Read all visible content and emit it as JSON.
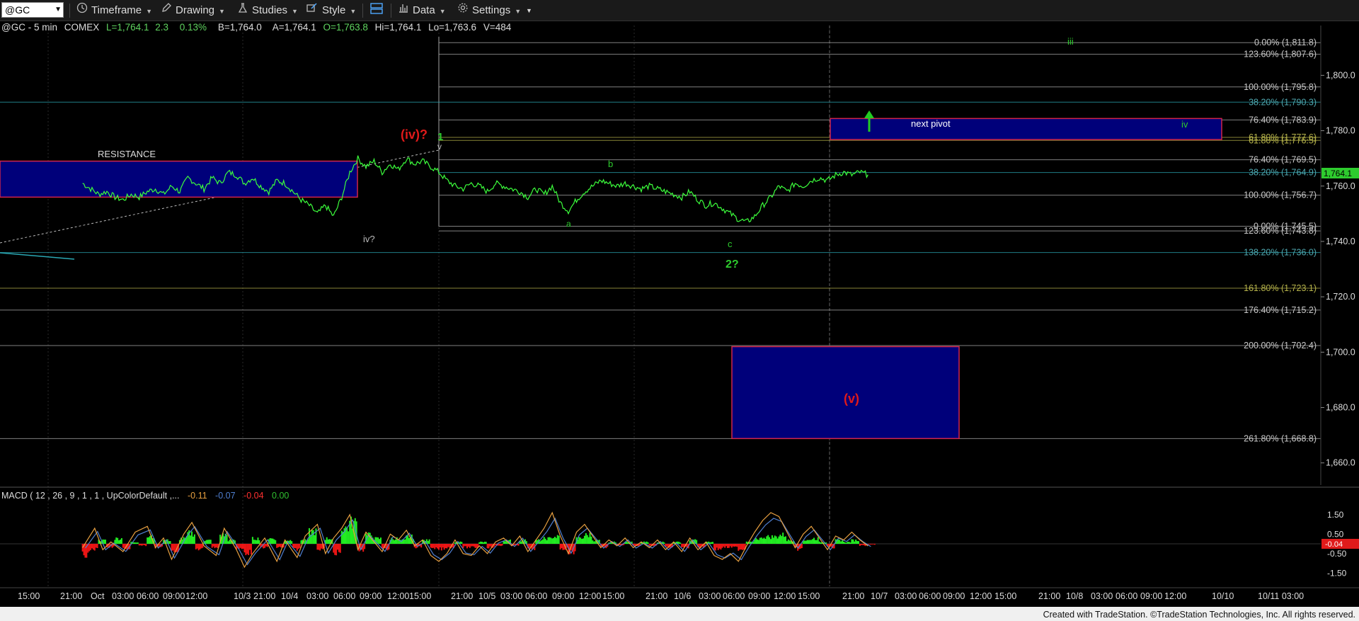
{
  "toolbar": {
    "symbol": "@GC",
    "timeframe": "Timeframe",
    "drawing": "Drawing",
    "studies": "Studies",
    "style": "Style",
    "data": "Data",
    "settings": "Settings"
  },
  "header": {
    "symbol": "@GC - 5 min",
    "exchange": "COMEX",
    "last": "L=1,764.1",
    "change": "2.3",
    "change_pct": "0.13%",
    "bid": "B=1,764.0",
    "ask": "A=1,764.1",
    "open": "O=1,763.8",
    "high": "Hi=1,764.1",
    "low": "Lo=1,763.6",
    "volume": "V=484"
  },
  "price_axis": {
    "ticks": [
      "1,800.0",
      "1,780.0",
      "1,760.0",
      "1,740.0",
      "1,720.0",
      "1,700.0",
      "1,680.0",
      "1,660.0"
    ],
    "last_price": "1,764.1"
  },
  "fib_labels": [
    {
      "text": "0.00% (1,811.8)",
      "color": "#c8c8c8"
    },
    {
      "text": "123.60% (1,807.6)",
      "color": "#c8c8c8"
    },
    {
      "text": "100.00% (1,795.8)",
      "color": "#c8c8c8"
    },
    {
      "text": "38.20% (1,790.3)",
      "color": "#4fa8b0"
    },
    {
      "text": "76.40% (1,783.9)",
      "color": "#c8c8c8"
    },
    {
      "text": "61.80% (1,777.6)",
      "color": "#b5b24a"
    },
    {
      "text": "61.80% (1,776.5)",
      "color": "#b5b24a"
    },
    {
      "text": "76.40% (1,769.5)",
      "color": "#c8c8c8"
    },
    {
      "text": "38.20% (1,764.9)",
      "color": "#4fa8b0"
    },
    {
      "text": "100.00% (1,756.7)",
      "color": "#c8c8c8"
    },
    {
      "text": "0.00% (1,745.5)",
      "color": "#c8c8c8"
    },
    {
      "text": "123.60% (1,743.8)",
      "color": "#c8c8c8"
    },
    {
      "text": "138.20% (1,736.0)",
      "color": "#4fa8b0"
    },
    {
      "text": "161.80% (1,723.1)",
      "color": "#b5b24a"
    },
    {
      "text": "176.40% (1,715.2)",
      "color": "#c8c8c8"
    },
    {
      "text": "200.00% (1,702.4)",
      "color": "#c8c8c8"
    },
    {
      "text": "261.80% (1,668.8)",
      "color": "#c8c8c8"
    }
  ],
  "annotations": {
    "resistance": "RESISTANCE",
    "next_pivot": "next pivot",
    "wave_iv_red": "(iv)?",
    "wave_1": "1",
    "wave_v_small": "v",
    "wave_iv_q": "iv?",
    "wave_a": "a",
    "wave_b": "b",
    "wave_c": "c",
    "wave_2q": "2?",
    "wave_iii": "iii",
    "wave_iv_small": "iv",
    "wave_v_red": "(v)"
  },
  "macd": {
    "label": "MACD ( 12 , 26 , 9 , 1 , 1 , UpColorDefault ,...",
    "values": [
      "-0.11",
      "-0.07",
      "-0.04",
      "0.00"
    ],
    "value_colors": [
      "#e8a040",
      "#4f7fd0",
      "#ff3030",
      "#30c030"
    ],
    "ticks": [
      "1.50",
      "0.50",
      "-0.50",
      "-1.50"
    ],
    "current": "-0.04"
  },
  "time_axis": {
    "labels": [
      "15:00",
      "21:00",
      "Oct",
      "03:00",
      "06:00",
      "09:00",
      "12:00",
      "10/3",
      "21:00",
      "10/4",
      "03:00",
      "06:00",
      "09:00",
      "12:00",
      "15:00",
      "21:00",
      "10/5",
      "03:00",
      "06:00",
      "09:00",
      "12:00",
      "15:00",
      "21:00",
      "10/6",
      "03:00",
      "06:00",
      "09:00",
      "12:00",
      "15:00",
      "21:00",
      "10/7",
      "03:00",
      "06:00",
      "09:00",
      "12:00",
      "15:00",
      "21:00",
      "10/8",
      "03:00",
      "06:00",
      "09:00",
      "12:00",
      "10/10",
      "10/11 03:00"
    ]
  },
  "footer": "Created with TradeStation. ©TradeStation Technologies, Inc. All rights reserved.",
  "chart_data": {
    "type": "line",
    "title": "@GC - 5 min COMEX",
    "ylabel": "",
    "ylim": [
      1652,
      1818
    ],
    "last": 1764.1,
    "price_path": [
      [
        0,
        1761
      ],
      [
        0.02,
        1759
      ],
      [
        0.04,
        1757
      ],
      [
        0.06,
        1758
      ],
      [
        0.08,
        1756
      ],
      [
        0.1,
        1755
      ],
      [
        0.12,
        1757
      ],
      [
        0.14,
        1756
      ],
      [
        0.16,
        1758
      ],
      [
        0.18,
        1759
      ],
      [
        0.2,
        1757
      ],
      [
        0.22,
        1760
      ],
      [
        0.24,
        1758
      ],
      [
        0.26,
        1763
      ],
      [
        0.28,
        1761
      ],
      [
        0.3,
        1759
      ],
      [
        0.32,
        1763
      ],
      [
        0.34,
        1761
      ],
      [
        0.36,
        1765
      ],
      [
        0.38,
        1764
      ],
      [
        0.4,
        1761
      ],
      [
        0.42,
        1763
      ],
      [
        0.44,
        1760
      ],
      [
        0.46,
        1758
      ],
      [
        0.48,
        1762
      ],
      [
        0.5,
        1761
      ],
      [
        0.52,
        1758
      ],
      [
        0.54,
        1755
      ],
      [
        0.56,
        1753
      ],
      [
        0.58,
        1750
      ],
      [
        0.6,
        1753
      ],
      [
        0.62,
        1749
      ],
      [
        0.64,
        1756
      ],
      [
        0.66,
        1765
      ],
      [
        0.68,
        1770
      ],
      [
        0.7,
        1767
      ],
      [
        0.72,
        1769
      ],
      [
        0.74,
        1765
      ],
      [
        0.76,
        1768
      ],
      [
        0.78,
        1766
      ],
      [
        0.8,
        1770
      ],
      [
        0.82,
        1768
      ],
      [
        0.84,
        1769
      ],
      [
        0.86,
        1767
      ],
      [
        0.88,
        1765
      ],
      [
        0.9,
        1762
      ],
      [
        0.92,
        1760
      ],
      [
        0.94,
        1759
      ],
      [
        0.96,
        1761
      ],
      [
        0.98,
        1760
      ],
      [
        1,
        1758
      ],
      [
        1.02,
        1761
      ],
      [
        1.04,
        1760
      ],
      [
        1.06,
        1759
      ],
      [
        1.08,
        1758
      ],
      [
        1.1,
        1756
      ],
      [
        1.12,
        1759
      ],
      [
        1.14,
        1757
      ],
      [
        1.16,
        1760
      ],
      [
        1.18,
        1754
      ],
      [
        1.2,
        1751
      ],
      [
        1.22,
        1755
      ],
      [
        1.24,
        1758
      ],
      [
        1.26,
        1760
      ],
      [
        1.28,
        1762
      ],
      [
        1.3,
        1761
      ],
      [
        1.32,
        1760
      ],
      [
        1.34,
        1761
      ],
      [
        1.36,
        1760
      ],
      [
        1.38,
        1759
      ],
      [
        1.4,
        1760
      ],
      [
        1.42,
        1759
      ],
      [
        1.44,
        1758
      ],
      [
        1.46,
        1757
      ],
      [
        1.48,
        1756
      ],
      [
        1.5,
        1758
      ],
      [
        1.52,
        1755
      ],
      [
        1.54,
        1753
      ],
      [
        1.56,
        1754
      ],
      [
        1.58,
        1752
      ],
      [
        1.6,
        1750
      ],
      [
        1.62,
        1748
      ],
      [
        1.64,
        1747
      ],
      [
        1.66,
        1749
      ],
      [
        1.68,
        1753
      ],
      [
        1.7,
        1756
      ],
      [
        1.72,
        1760
      ],
      [
        1.74,
        1758
      ],
      [
        1.76,
        1761
      ],
      [
        1.78,
        1760
      ],
      [
        1.8,
        1762
      ],
      [
        1.82,
        1763
      ],
      [
        1.84,
        1762
      ],
      [
        1.86,
        1764
      ],
      [
        1.88,
        1765
      ],
      [
        1.9,
        1764
      ],
      [
        1.92,
        1765
      ],
      [
        1.94,
        1764.1
      ]
    ],
    "fib_levels": [
      1811.8,
      1807.6,
      1795.8,
      1790.3,
      1783.9,
      1777.6,
      1776.5,
      1769.5,
      1764.9,
      1756.7,
      1745.5,
      1743.8,
      1736.0,
      1723.1,
      1715.2,
      1702.4,
      1668.8
    ],
    "zones": [
      {
        "label": "RESISTANCE",
        "top": 1769.0,
        "bottom": 1756.0
      },
      {
        "label": "next pivot",
        "top": 1784.4,
        "bottom": 1776.8
      },
      {
        "label": "(v)",
        "top": 1702.0,
        "bottom": 1668.8
      }
    ],
    "macd": {
      "ylim": [
        -2.2,
        2.2
      ],
      "hist": [
        [
          0,
          -0.6
        ],
        [
          0.02,
          -0.3
        ],
        [
          0.04,
          0.2
        ],
        [
          0.06,
          -0.2
        ],
        [
          0.08,
          0.3
        ],
        [
          0.1,
          -0.3
        ],
        [
          0.12,
          0.1
        ],
        [
          0.14,
          -0.1
        ],
        [
          0.16,
          0.4
        ],
        [
          0.18,
          -0.2
        ],
        [
          0.2,
          0.2
        ],
        [
          0.22,
          -0.4
        ],
        [
          0.24,
          0.3
        ],
        [
          0.26,
          0.6
        ],
        [
          0.28,
          -0.3
        ],
        [
          0.3,
          0.2
        ],
        [
          0.32,
          -0.2
        ],
        [
          0.34,
          0.5
        ],
        [
          0.36,
          0.2
        ],
        [
          0.38,
          -0.3
        ],
        [
          0.4,
          -0.5
        ],
        [
          0.42,
          0.3
        ],
        [
          0.44,
          -0.2
        ],
        [
          0.46,
          0.3
        ],
        [
          0.48,
          -0.2
        ],
        [
          0.5,
          0.2
        ],
        [
          0.52,
          -0.3
        ],
        [
          0.54,
          0.2
        ],
        [
          0.56,
          0.7
        ],
        [
          0.58,
          -0.3
        ],
        [
          0.6,
          0.3
        ],
        [
          0.62,
          -0.5
        ],
        [
          0.64,
          0.9
        ],
        [
          0.66,
          1.2
        ],
        [
          0.68,
          -0.4
        ],
        [
          0.7,
          0.5
        ],
        [
          0.72,
          0.3
        ],
        [
          0.74,
          -0.3
        ],
        [
          0.76,
          0.3
        ],
        [
          0.78,
          0.2
        ],
        [
          0.8,
          0.4
        ],
        [
          0.82,
          -0.2
        ],
        [
          0.84,
          0.2
        ],
        [
          0.86,
          -0.3
        ],
        [
          0.88,
          -0.3
        ],
        [
          0.9,
          -0.2
        ],
        [
          0.92,
          0.1
        ],
        [
          0.94,
          -0.2
        ],
        [
          0.96,
          -0.2
        ],
        [
          0.98,
          0.1
        ],
        [
          1,
          -0.2
        ],
        [
          1.02,
          -0.1
        ],
        [
          1.04,
          0.2
        ],
        [
          1.06,
          -0.1
        ],
        [
          1.08,
          0.2
        ],
        [
          1.1,
          -0.3
        ],
        [
          1.12,
          0.2
        ],
        [
          1.14,
          0.3
        ],
        [
          1.16,
          0.4
        ],
        [
          1.18,
          -0.3
        ],
        [
          1.2,
          -0.5
        ],
        [
          1.22,
          0.3
        ],
        [
          1.24,
          0.5
        ],
        [
          1.26,
          0.2
        ],
        [
          1.28,
          -0.2
        ],
        [
          1.3,
          0.1
        ],
        [
          1.32,
          -0.1
        ],
        [
          1.34,
          0.1
        ],
        [
          1.36,
          -0.1
        ],
        [
          1.38,
          0.1
        ],
        [
          1.4,
          -0.1
        ],
        [
          1.42,
          0.1
        ],
        [
          1.44,
          -0.2
        ],
        [
          1.46,
          0.1
        ],
        [
          1.48,
          -0.2
        ],
        [
          1.5,
          0.2
        ],
        [
          1.52,
          -0.2
        ],
        [
          1.54,
          0.1
        ],
        [
          1.56,
          -0.3
        ],
        [
          1.58,
          -0.2
        ],
        [
          1.6,
          -0.2
        ],
        [
          1.62,
          -0.3
        ],
        [
          1.64,
          0.1
        ],
        [
          1.66,
          0.3
        ],
        [
          1.68,
          0.4
        ],
        [
          1.7,
          0.4
        ],
        [
          1.72,
          0.5
        ],
        [
          1.74,
          0.2
        ],
        [
          1.76,
          -0.3
        ],
        [
          1.78,
          0.2
        ],
        [
          1.8,
          0.3
        ],
        [
          1.82,
          0.1
        ],
        [
          1.84,
          -0.2
        ],
        [
          1.86,
          0.2
        ],
        [
          1.88,
          0.1
        ],
        [
          1.9,
          0.2
        ],
        [
          1.92,
          -0.1
        ],
        [
          1.94,
          -0.04
        ]
      ],
      "macd_line": [
        [
          0,
          -0.2
        ],
        [
          0.03,
          0.8
        ],
        [
          0.05,
          -0.3
        ],
        [
          0.07,
          0.1
        ],
        [
          0.1,
          -0.4
        ],
        [
          0.13,
          0.6
        ],
        [
          0.16,
          0.9
        ],
        [
          0.18,
          -0.2
        ],
        [
          0.2,
          0.3
        ],
        [
          0.22,
          -0.8
        ],
        [
          0.25,
          0.5
        ],
        [
          0.27,
          1.1
        ],
        [
          0.3,
          -0.1
        ],
        [
          0.33,
          -0.6
        ],
        [
          0.35,
          0.8
        ],
        [
          0.38,
          -0.3
        ],
        [
          0.4,
          -1.2
        ],
        [
          0.42,
          -0.5
        ],
        [
          0.45,
          0.3
        ],
        [
          0.48,
          -0.9
        ],
        [
          0.5,
          0.2
        ],
        [
          0.53,
          -0.7
        ],
        [
          0.55,
          0.4
        ],
        [
          0.58,
          1.0
        ],
        [
          0.6,
          -0.5
        ],
        [
          0.62,
          0.3
        ],
        [
          0.64,
          0.8
        ],
        [
          0.66,
          1.5
        ],
        [
          0.68,
          -0.3
        ],
        [
          0.7,
          0.6
        ],
        [
          0.72,
          0.1
        ],
        [
          0.74,
          -0.4
        ],
        [
          0.76,
          0.5
        ],
        [
          0.78,
          0.2
        ],
        [
          0.8,
          0.7
        ],
        [
          0.82,
          -0.1
        ],
        [
          0.84,
          0.2
        ],
        [
          0.86,
          -0.6
        ],
        [
          0.88,
          -0.9
        ],
        [
          0.9,
          -0.5
        ],
        [
          0.92,
          0.2
        ],
        [
          0.94,
          -0.5
        ],
        [
          0.96,
          -0.6
        ],
        [
          0.98,
          -0.1
        ],
        [
          1,
          -0.5
        ],
        [
          1.02,
          0.1
        ],
        [
          1.04,
          0.3
        ],
        [
          1.06,
          -0.1
        ],
        [
          1.08,
          0.4
        ],
        [
          1.1,
          -0.4
        ],
        [
          1.12,
          0.2
        ],
        [
          1.14,
          0.8
        ],
        [
          1.16,
          1.6
        ],
        [
          1.18,
          0.4
        ],
        [
          1.2,
          -0.5
        ],
        [
          1.22,
          0.6
        ],
        [
          1.24,
          1.0
        ],
        [
          1.26,
          0.4
        ],
        [
          1.28,
          -0.2
        ],
        [
          1.3,
          0.2
        ],
        [
          1.32,
          -0.1
        ],
        [
          1.34,
          0.3
        ],
        [
          1.36,
          -0.2
        ],
        [
          1.38,
          0.1
        ],
        [
          1.4,
          -0.2
        ],
        [
          1.42,
          0.2
        ],
        [
          1.44,
          -0.3
        ],
        [
          1.46,
          0.1
        ],
        [
          1.48,
          -0.4
        ],
        [
          1.5,
          0.3
        ],
        [
          1.52,
          -0.3
        ],
        [
          1.54,
          0.1
        ],
        [
          1.56,
          -0.6
        ],
        [
          1.58,
          -0.8
        ],
        [
          1.6,
          -0.5
        ],
        [
          1.62,
          -0.9
        ],
        [
          1.64,
          -0.1
        ],
        [
          1.66,
          0.6
        ],
        [
          1.68,
          1.2
        ],
        [
          1.7,
          1.6
        ],
        [
          1.72,
          1.4
        ],
        [
          1.74,
          0.6
        ],
        [
          1.76,
          -0.2
        ],
        [
          1.78,
          0.5
        ],
        [
          1.8,
          0.9
        ],
        [
          1.82,
          0.3
        ],
        [
          1.84,
          -0.3
        ],
        [
          1.86,
          0.4
        ],
        [
          1.88,
          0.2
        ],
        [
          1.9,
          0.6
        ],
        [
          1.92,
          0.2
        ],
        [
          1.94,
          -0.11
        ]
      ]
    }
  }
}
